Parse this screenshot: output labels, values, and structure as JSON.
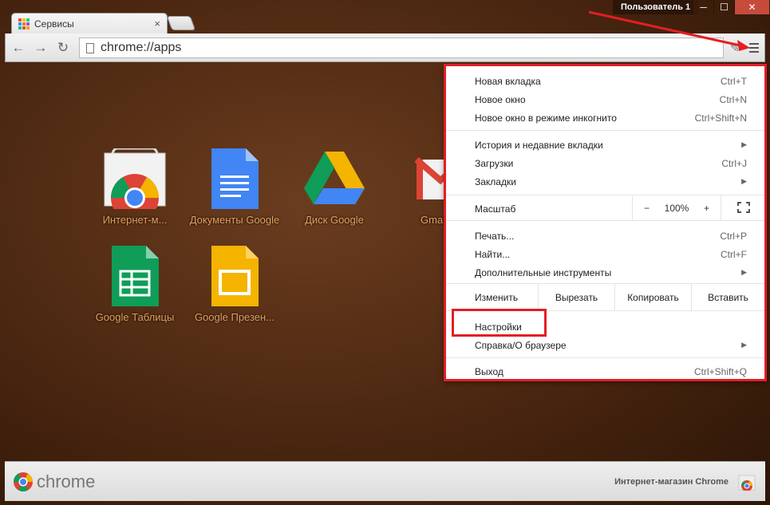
{
  "window": {
    "tab_title": "Сервисы",
    "tab_close": "×",
    "user_label": "Пользователь 1",
    "minimize": "─",
    "maximize": "☐",
    "close": "✕"
  },
  "toolbar": {
    "back": "←",
    "forward": "→",
    "reload": "↻",
    "address": "chrome://apps"
  },
  "apps": [
    {
      "label": "Интернет-м..."
    },
    {
      "label": "Документы Google"
    },
    {
      "label": "Диск Google"
    },
    {
      "label": "Gmail"
    },
    {
      "label": "Google Таблицы"
    },
    {
      "label": "Google Презен..."
    }
  ],
  "menu": {
    "new_tab": "Новая вкладка",
    "new_tab_sc": "Ctrl+T",
    "new_window": "Новое окно",
    "new_window_sc": "Ctrl+N",
    "incognito": "Новое окно в режиме инкогнито",
    "incognito_sc": "Ctrl+Shift+N",
    "history": "История и недавние вкладки",
    "downloads": "Загрузки",
    "downloads_sc": "Ctrl+J",
    "bookmarks": "Закладки",
    "zoom_label": "Масштаб",
    "zoom_minus": "−",
    "zoom_value": "100%",
    "zoom_plus": "+",
    "print": "Печать...",
    "print_sc": "Ctrl+P",
    "find": "Найти...",
    "find_sc": "Ctrl+F",
    "more_tools": "Дополнительные инструменты",
    "edit": "Изменить",
    "cut": "Вырезать",
    "copy": "Копировать",
    "paste": "Вставить",
    "settings": "Настройки",
    "help": "Справка/О браузере",
    "exit": "Выход",
    "exit_sc": "Ctrl+Shift+Q",
    "arrow": "▶"
  },
  "bottom": {
    "chrome_text": "chrome",
    "webstore": "Интернет-магазин Chrome"
  },
  "colors": {
    "annotation_red": "#e31e24",
    "label_orange": "#e0a060"
  }
}
